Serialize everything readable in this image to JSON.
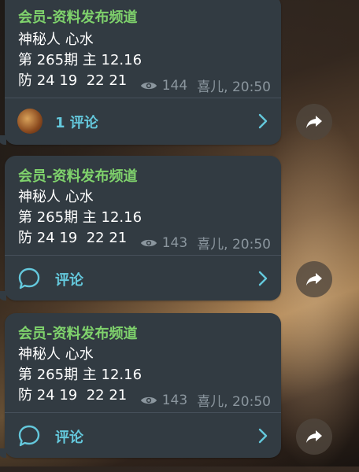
{
  "messages": [
    {
      "channel": "会员-资料发布频道",
      "lines": [
        "神秘人 心水",
        "第 265期 主 12.16",
        "防 24 19  22 21"
      ],
      "views": "144",
      "author_time": "喜儿, 20:50",
      "comment_label": "1 评论",
      "comment_kind": "avatar"
    },
    {
      "channel": "会员-资料发布频道",
      "lines": [
        "神秘人 心水",
        "第 265期 主 12.16",
        "防 24 19  22 21"
      ],
      "views": "143",
      "author_time": "喜儿, 20:50",
      "comment_label": "评论",
      "comment_kind": "chat-bubble-icon"
    },
    {
      "channel": "会员-资料发布频道",
      "lines": [
        "神秘人 心水",
        "第 265期 主 12.16",
        "防 24 19  22 21"
      ],
      "views": "143",
      "author_time": "喜儿, 20:50",
      "comment_label": "评论",
      "comment_kind": "chat-bubble-icon"
    }
  ],
  "colors": {
    "bubble": "#323b42",
    "channel_title": "#7fd26c",
    "comment_accent": "#64c8dc",
    "meta_text": "#8b969e"
  },
  "icons": [
    "eye-icon",
    "chat-bubble-icon",
    "chevron-right-icon",
    "share-icon"
  ]
}
